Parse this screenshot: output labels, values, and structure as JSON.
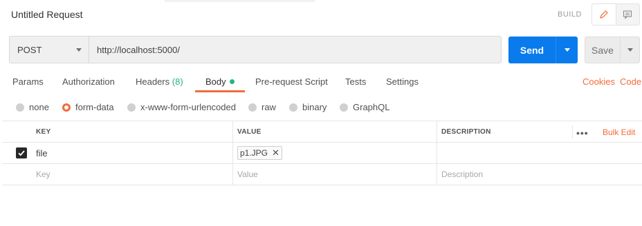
{
  "header": {
    "title": "Untitled Request",
    "build_label": "BUILD"
  },
  "request": {
    "method": "POST",
    "url": "http://localhost:5000/",
    "send_label": "Send",
    "save_label": "Save"
  },
  "tabs": [
    {
      "label": "Params"
    },
    {
      "label": "Authorization"
    },
    {
      "label": "Headers",
      "count": "(8)"
    },
    {
      "label": "Body",
      "active": true
    },
    {
      "label": "Pre-request Script"
    },
    {
      "label": "Tests"
    },
    {
      "label": "Settings"
    }
  ],
  "right_links": {
    "cookies": "Cookies",
    "code": "Code"
  },
  "body_types": [
    {
      "label": "none",
      "selected": false
    },
    {
      "label": "form-data",
      "selected": true
    },
    {
      "label": "x-www-form-urlencoded",
      "selected": false
    },
    {
      "label": "raw",
      "selected": false
    },
    {
      "label": "binary",
      "selected": false
    },
    {
      "label": "GraphQL",
      "selected": false
    }
  ],
  "table": {
    "headers": {
      "key": "KEY",
      "value": "VALUE",
      "description": "DESCRIPTION",
      "bulk_edit": "Bulk Edit",
      "more": "•••"
    },
    "rows": [
      {
        "checked": true,
        "key": "file",
        "value_file": "p1.JPG",
        "remove": "✕",
        "description": ""
      }
    ],
    "placeholders": {
      "key": "Key",
      "value": "Value",
      "description": "Description"
    }
  },
  "colors": {
    "accent": "#f26b3a",
    "send": "#097bed",
    "green": "#26b47f"
  }
}
